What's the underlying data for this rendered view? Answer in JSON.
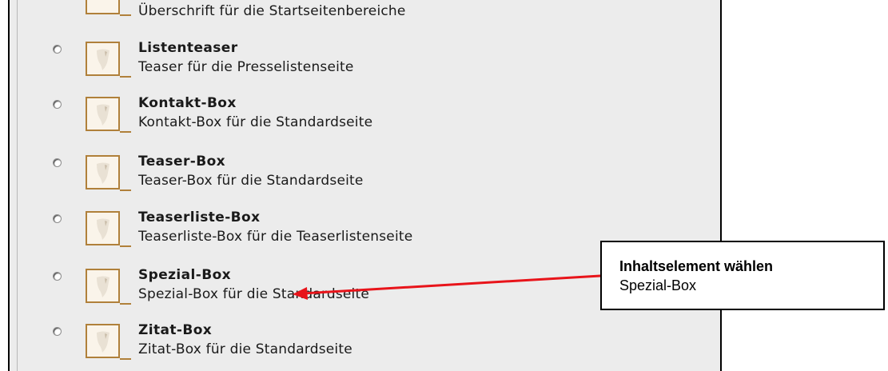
{
  "elements": [
    {
      "title": "",
      "desc": "Überschrift für die Startseitenbereiche"
    },
    {
      "title": "Listenteaser",
      "desc": "Teaser für die Presselistenseite"
    },
    {
      "title": "Kontakt-Box",
      "desc": "Kontakt-Box für die Standardseite"
    },
    {
      "title": "Teaser-Box",
      "desc": "Teaser-Box für die Standardseite"
    },
    {
      "title": "Teaserliste-Box",
      "desc": "Teaserliste-Box für die Teaserlistenseite"
    },
    {
      "title": "Spezial-Box",
      "desc": "Spezial-Box für die Standardseite"
    },
    {
      "title": "Zitat-Box",
      "desc": "Zitat-Box für die Standardseite"
    }
  ],
  "callout": {
    "title": "Inhaltselement wählen",
    "text": "Spezial-Box"
  },
  "colors": {
    "panel": "#ececec",
    "icon_border": "#b0803a",
    "arrow": "#e8141a"
  },
  "icons": {
    "element_icon": "content-element-icon",
    "radio": "radio-button"
  }
}
